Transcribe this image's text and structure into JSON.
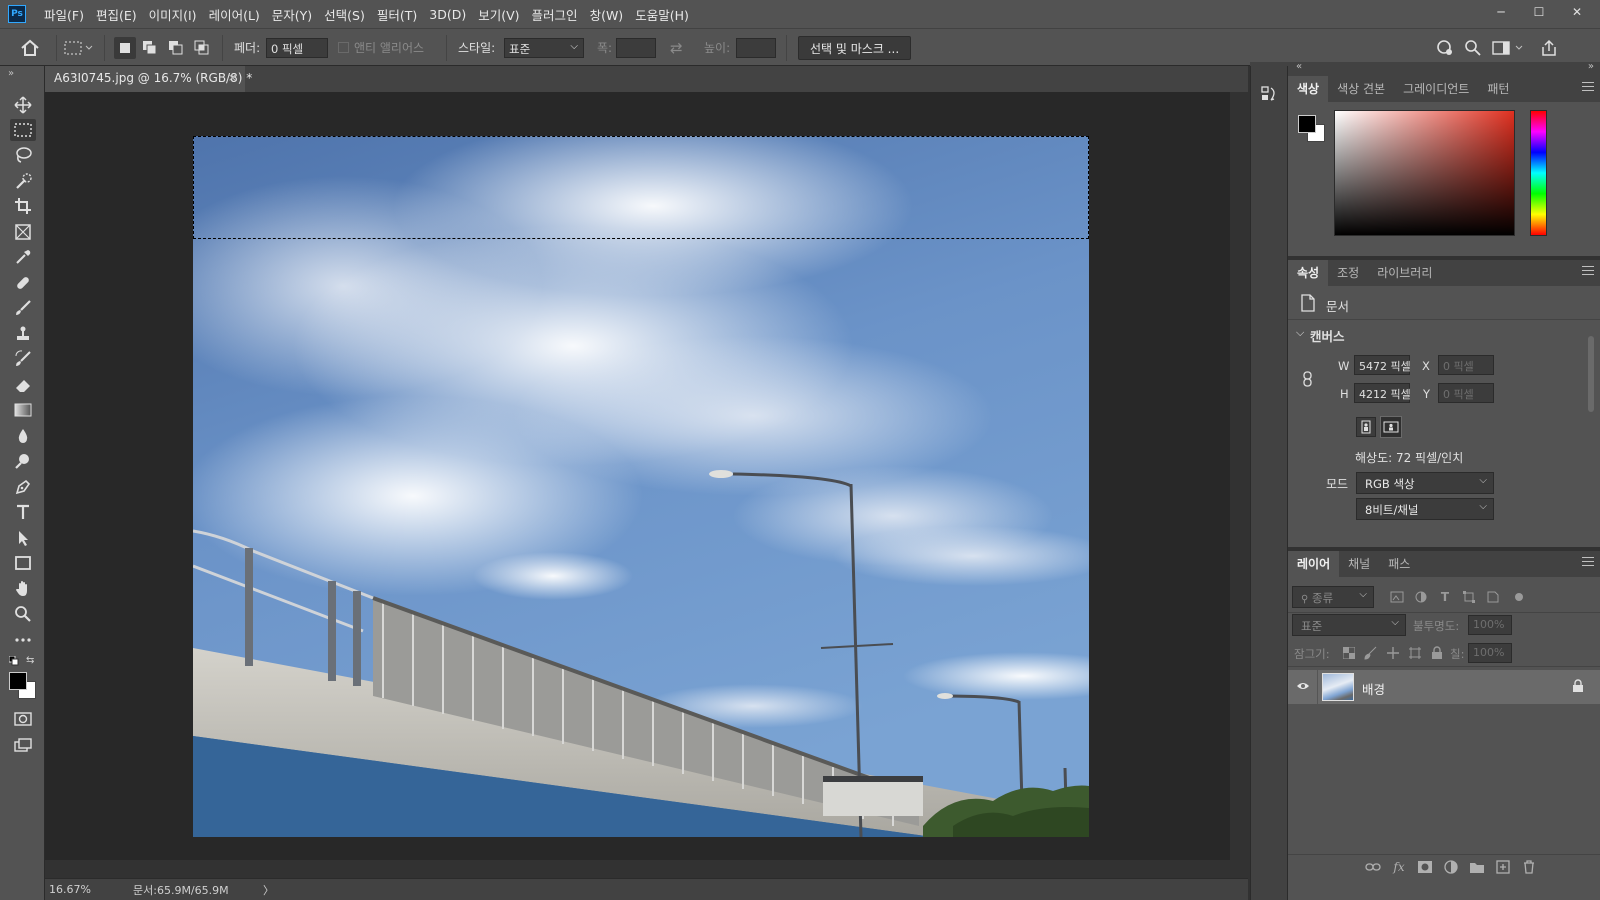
{
  "app": {
    "logo": "Ps",
    "menu": [
      "파일(F)",
      "편집(E)",
      "이미지(I)",
      "레이어(L)",
      "문자(Y)",
      "선택(S)",
      "필터(T)",
      "3D(D)",
      "보기(V)",
      "플러그인",
      "창(W)",
      "도움말(H)"
    ],
    "window_controls": {
      "minimize": "─",
      "maximize": "☐",
      "close": "✕"
    }
  },
  "options": {
    "feather_label": "페더:",
    "feather_value": "0 픽셀",
    "antialias_label": "앤티 앨리어스",
    "style_label": "스타일:",
    "style_value": "표준",
    "width_label": "폭:",
    "swap_icon": "⇄",
    "height_label": "높이:",
    "select_mask_button": "선택 및 마스크 ..."
  },
  "document": {
    "tab_title": "A63I0745.jpg @ 16.7% (RGB/8) *",
    "close": "×"
  },
  "status": {
    "zoom": "16.67%",
    "doc_size": "문서:65.9M/65.9M",
    "arrow": "〉"
  },
  "color_panel": {
    "tabs": [
      "색상",
      "색상 견본",
      "그레이디언트",
      "패턴"
    ],
    "active_tab": 0,
    "fg_color": "#000000",
    "bg_color": "#ffffff"
  },
  "properties_panel": {
    "tabs": [
      "속성",
      "조정",
      "라이브러리"
    ],
    "active_tab": 0,
    "doc_label": "문서",
    "section_title": "캔버스",
    "w_label": "W",
    "w_value": "5472 픽셀",
    "h_label": "H",
    "h_value": "4212 픽셀",
    "x_label": "X",
    "x_value": "0 픽셀",
    "y_label": "Y",
    "y_value": "0 픽셀",
    "resolution": "해상도: 72 픽셀/인치",
    "mode_label": "모드",
    "mode_value": "RGB 색상",
    "depth_value": "8비트/채널"
  },
  "layers_panel": {
    "tabs": [
      "레이어",
      "채널",
      "패스"
    ],
    "active_tab": 0,
    "filter_placeholder": "종류",
    "blend_mode": "표준",
    "opacity_label": "불투명도:",
    "opacity_value": "100%",
    "lock_label": "잠그기:",
    "fill_label": "칠:",
    "fill_value": "100%",
    "layers": [
      {
        "name": "배경",
        "visible": true,
        "locked": true
      }
    ]
  },
  "icons": {
    "home": "home-icon",
    "marquee": "rect-marquee-icon",
    "move": "move-icon",
    "lasso": "lasso-icon",
    "quick_select": "quick-select-icon",
    "crop": "crop-icon",
    "frame": "frame-icon",
    "eyedropper": "eyedropper-icon",
    "healing": "healing-brush-icon",
    "brush": "brush-icon",
    "stamp": "clone-stamp-icon",
    "history_brush": "history-brush-icon",
    "eraser": "eraser-icon",
    "gradient": "gradient-icon",
    "blur": "blur-icon",
    "dodge": "dodge-icon",
    "pen": "pen-icon",
    "type": "type-icon",
    "path_select": "path-select-icon",
    "shape": "rectangle-icon",
    "hand": "hand-icon",
    "zoom": "zoom-icon"
  }
}
